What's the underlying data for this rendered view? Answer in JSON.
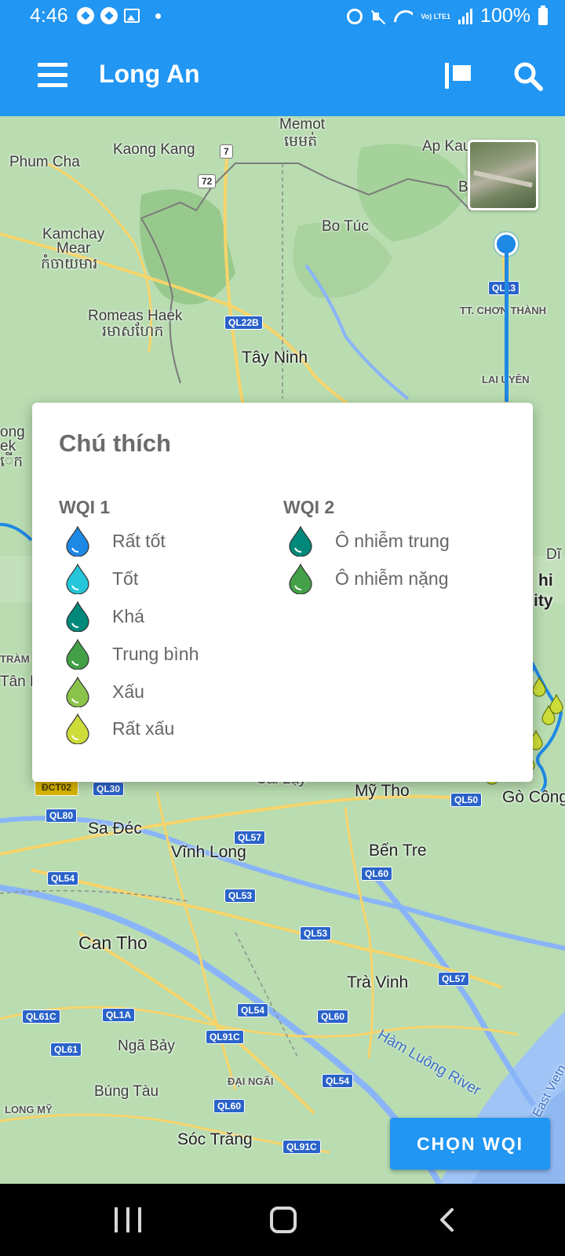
{
  "status_bar": {
    "time": "4:46",
    "battery": "100%",
    "network": "Vo) LTE1"
  },
  "app_bar": {
    "title": "Long An"
  },
  "map": {
    "places": [
      {
        "id": "memot",
        "text": "Memot"
      },
      {
        "id": "memot_km",
        "text": "មេមត់"
      },
      {
        "id": "kaong_kang",
        "text": "Kaong Kang"
      },
      {
        "id": "phum_cha",
        "text": "Phum Cha"
      },
      {
        "id": "ap_kau",
        "text": "Ap Kau"
      },
      {
        "id": "b",
        "text": "B"
      },
      {
        "id": "kamchay_mear",
        "text": "Kamchay"
      },
      {
        "id": "kamchay_mear2",
        "text": "Mear"
      },
      {
        "id": "kamchay_km",
        "text": "កំចាយមារ"
      },
      {
        "id": "bo_tuc",
        "text": "Bo Túc"
      },
      {
        "id": "romeas_haek",
        "text": "Romeas Haek"
      },
      {
        "id": "romeas_km",
        "text": "រមាសហែក"
      },
      {
        "id": "tay_ninh",
        "text": "Tây Ninh"
      },
      {
        "id": "tt_chon_thanh",
        "text": "TT. CHƠN THÀNH"
      },
      {
        "id": "lai_uyen",
        "text": "LAI UYÊN"
      },
      {
        "id": "left_ong",
        "text": "ong"
      },
      {
        "id": "left_ek",
        "text": "ek"
      },
      {
        "id": "left_km",
        "text": "ើក"
      },
      {
        "id": "right_di",
        "text": "Dĩ"
      },
      {
        "id": "right_hi",
        "text": "hi"
      },
      {
        "id": "right_ity",
        "text": "ity"
      },
      {
        "id": "tram",
        "text": "TRÀM"
      },
      {
        "id": "tan_m",
        "text": "Tân M"
      },
      {
        "id": "cai_lay",
        "text": "Cai Lậy"
      },
      {
        "id": "my_tho",
        "text": "Mỹ Tho"
      },
      {
        "id": "go_cong",
        "text": "Gò Công"
      },
      {
        "id": "sa_dec",
        "text": "Sa Đéc"
      },
      {
        "id": "vinh_long",
        "text": "Vĩnh Long"
      },
      {
        "id": "ben_tre",
        "text": "Bến Tre"
      },
      {
        "id": "can_tho",
        "text": "Can Tho"
      },
      {
        "id": "tra_vinh",
        "text": "Trà Vinh"
      },
      {
        "id": "nga_bay",
        "text": "Ngã Bảy"
      },
      {
        "id": "bung_tau",
        "text": "Búng Tàu"
      },
      {
        "id": "dai_ngai",
        "text": "ĐẠI NGÃI"
      },
      {
        "id": "long_my",
        "text": "LONG MỸ"
      },
      {
        "id": "soc_trang",
        "text": "Sóc Trăng"
      },
      {
        "id": "east_viet",
        "text": "East Vietn"
      }
    ],
    "river_label": "Hàm Luông River",
    "roads": [
      "7",
      "72",
      "QL22B",
      "QL13",
      "ĐCT02",
      "QL30",
      "QL80",
      "QL57",
      "QL50",
      "QL54",
      "QL60",
      "QL53",
      "QL53",
      "QL57",
      "QL61C",
      "QL1A",
      "QL54",
      "QL60",
      "QL61",
      "QL91C",
      "QL54",
      "QL60",
      "QL91C"
    ]
  },
  "legend": {
    "title": "Chú thích",
    "wqi1": {
      "heading": "WQI 1",
      "items": [
        {
          "label": "Rất tốt",
          "color": "#1e88e5"
        },
        {
          "label": "Tốt",
          "color": "#26c6da"
        },
        {
          "label": "Khá",
          "color": "#00897b"
        },
        {
          "label": "Trung bình",
          "color": "#43a047"
        },
        {
          "label": "Xấu",
          "color": "#8bc34a"
        },
        {
          "label": "Rất xấu",
          "color": "#cddc39"
        }
      ]
    },
    "wqi2": {
      "heading": "WQI 2",
      "items": [
        {
          "label": "Ô nhiễm trung",
          "color": "#00897b"
        },
        {
          "label": "Ô nhiễm nặng",
          "color": "#43a047"
        }
      ]
    }
  },
  "choose_button": {
    "label": "CHỌN WQI"
  },
  "colors": {
    "primary": "#2196f3",
    "map_base": "#b9dcb1"
  }
}
